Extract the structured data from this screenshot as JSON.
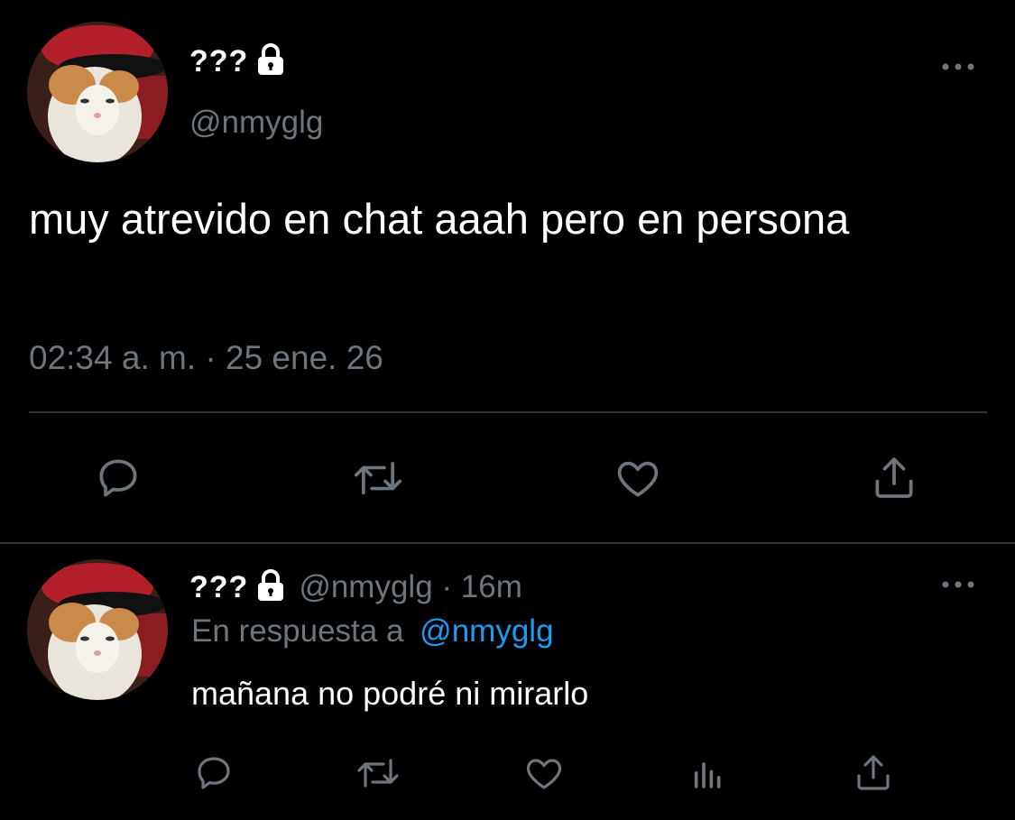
{
  "colors": {
    "background": "#000000",
    "text": "#ffffff",
    "muted": "#6e767d",
    "link": "#1d9bf0",
    "divider": "#2f3336"
  },
  "main_tweet": {
    "display_name": "???",
    "handle": "@nmyglg",
    "protected_icon": "lock-icon",
    "text": "muy atrevido en chat aaah pero en persona",
    "timestamp": "02:34 a. m. · 25 ene. 26",
    "more_icon": "more-horizontal-icon",
    "actions": [
      "reply-icon",
      "retweet-icon",
      "like-icon",
      "share-icon"
    ]
  },
  "reply_tweet": {
    "display_name": "???",
    "handle_time": "@nmyglg · 16m",
    "protected_icon": "lock-icon",
    "replying_prefix": "En respuesta a",
    "replying_to": "@nmyglg",
    "text": "mañana no podré ni mirarlo",
    "more_icon": "more-horizontal-icon",
    "actions": [
      "reply-icon",
      "retweet-icon",
      "like-icon",
      "analytics-icon",
      "share-icon"
    ]
  }
}
